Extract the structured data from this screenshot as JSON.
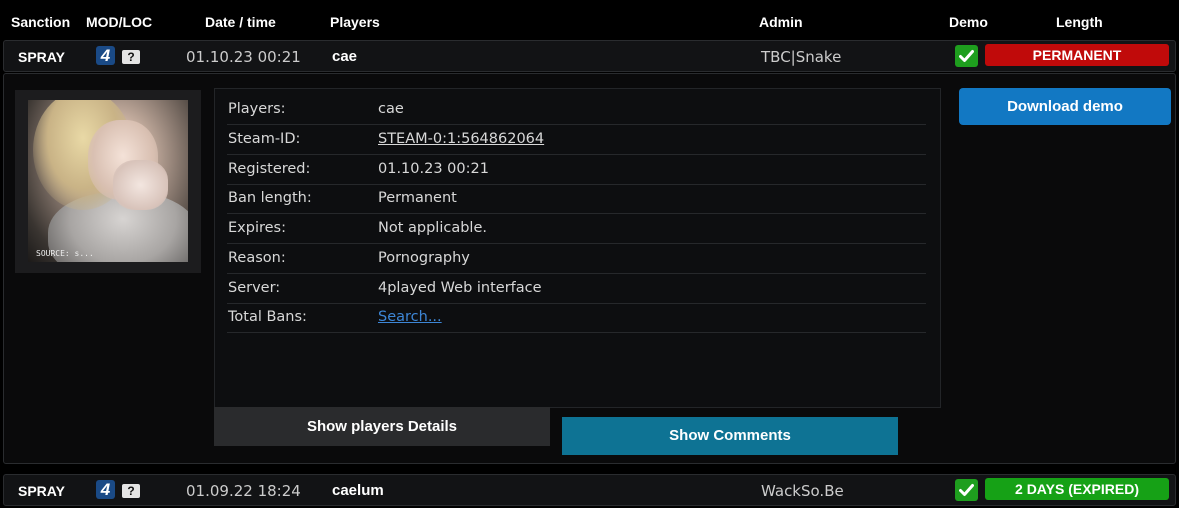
{
  "header": {
    "sanction": "Sanction",
    "modloc": "MOD/LOC",
    "datetime": "Date / time",
    "players": "Players",
    "admin": "Admin",
    "demo": "Demo",
    "length": "Length"
  },
  "bans": [
    {
      "sanction": "SPRAY",
      "mod_icon_text": "4",
      "loc_icon_text": "?",
      "date": "01.10.23 00:21",
      "player": "cae",
      "admin": "TBC|Snake",
      "length": "PERMANENT",
      "length_color": "#c00a0a"
    },
    {
      "sanction": "SPRAY",
      "mod_icon_text": "4",
      "loc_icon_text": "?",
      "date": "01.09.22 18:24",
      "player": "caelum",
      "admin": "WackSo.Be",
      "length": "2 DAYS (EXPIRED)",
      "length_color": "#16a116"
    }
  ],
  "detail": {
    "avatar_caption": "SOURCE: s...",
    "rows": [
      {
        "label": "Players:",
        "value": "cae"
      },
      {
        "label": "Steam-ID:",
        "value": "STEAM-0:1:564862064"
      },
      {
        "label": "Registered:",
        "value": "01.10.23 00:21"
      },
      {
        "label": "Ban length:",
        "value": "Permanent"
      },
      {
        "label": "Expires:",
        "value": "Not applicable."
      },
      {
        "label": "Reason:",
        "value": "Pornography"
      },
      {
        "label": "Server:",
        "value": "4played Web interface"
      },
      {
        "label": "Total Bans:",
        "value": "Search..."
      }
    ],
    "show_players_details": "Show players Details",
    "show_comments": "Show Comments",
    "download_demo": "Download demo"
  },
  "colors": {
    "demo_ok": "#1e9e1e",
    "comments_button": "#0e7394",
    "download_button": "#1278c3",
    "link_blue": "#3d86d6"
  },
  "icons": {
    "demo": "checkmark-icon",
    "mod": "mod-4-icon",
    "loc": "unknown-location-icon"
  }
}
